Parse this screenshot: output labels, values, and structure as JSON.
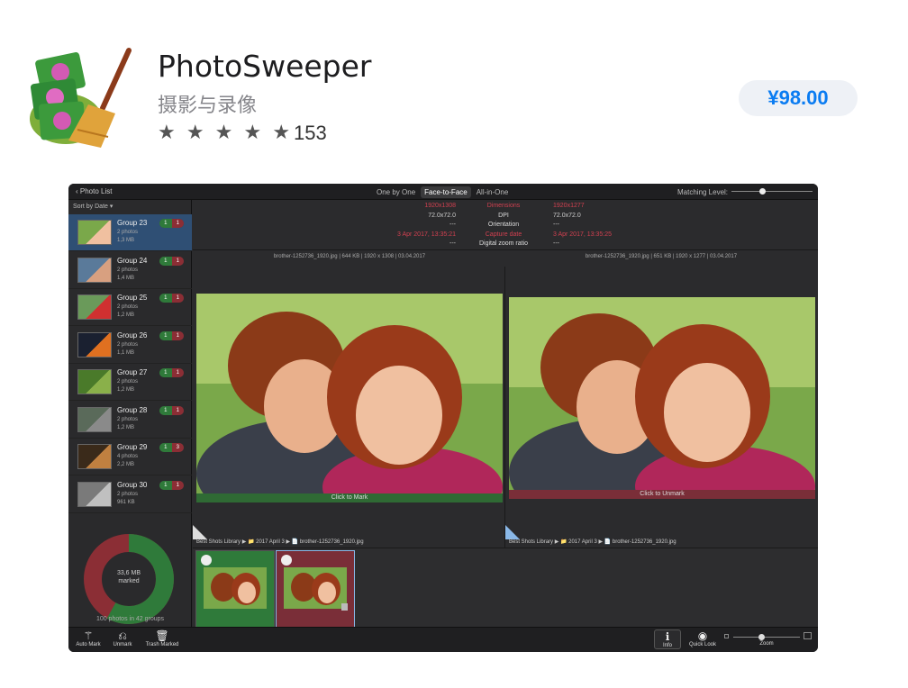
{
  "app": {
    "title": "PhotoSweeper",
    "category": "摄影与录像",
    "stars": "★ ★ ★ ★ ★",
    "rating_count": "153",
    "price": "¥98.00"
  },
  "toolbar": {
    "back": "Photo List",
    "modes": [
      "One by One",
      "Face-to-Face",
      "All-in-One"
    ],
    "matching_label": "Matching Level:"
  },
  "sidebar": {
    "sort": "Sort by Date ▾",
    "groups": [
      {
        "name": "Group 23",
        "photos": "2 photos",
        "size": "1,3 MB",
        "b1": "1",
        "b2": "1"
      },
      {
        "name": "Group 24",
        "photos": "2 photos",
        "size": "1,4 MB",
        "b1": "1",
        "b2": "1"
      },
      {
        "name": "Group 25",
        "photos": "2 photos",
        "size": "1,2 MB",
        "b1": "1",
        "b2": "1"
      },
      {
        "name": "Group 26",
        "photos": "2 photos",
        "size": "1,1 MB",
        "b1": "1",
        "b2": "1"
      },
      {
        "name": "Group 27",
        "photos": "2 photos",
        "size": "1,2 MB",
        "b1": "1",
        "b2": "1"
      },
      {
        "name": "Group 28",
        "photos": "2 photos",
        "size": "1,2 MB",
        "b1": "1",
        "b2": "1"
      },
      {
        "name": "Group 29",
        "photos": "4 photos",
        "size": "2,2 MB",
        "b1": "1",
        "b2": "3"
      },
      {
        "name": "Group 30",
        "photos": "2 photos",
        "size": "961 KB",
        "b1": "1",
        "b2": "1"
      }
    ],
    "marked_size": "33,6 MB",
    "marked_label": "marked",
    "marked_fraction": 0.58,
    "photo_count": "100 photos in 42 groups"
  },
  "info": {
    "labels": [
      "Dimensions",
      "DPI",
      "Orientation",
      "Capture date",
      "Digital zoom ratio"
    ],
    "left": [
      "1920x1308",
      "72.0x72.0",
      "---",
      "3 Apr 2017, 13:35:21",
      "---"
    ],
    "right": [
      "1920x1277",
      "72.0x72.0",
      "---",
      "3 Apr 2017, 13:35:25",
      "---"
    ]
  },
  "left_photo": {
    "header": "brother-1252736_1920.jpg | 644 KB | 1920 x 1308 | 03.04.2017",
    "bar": "Click to Mark",
    "path": "Best Shots Library ▶ 📁 2017 April 3 ▶ 📄 brother-1252736_1920.jpg"
  },
  "right_photo": {
    "header": "brother-1252736_1920.jpg | 651 KB | 1920 x 1277 | 03.04.2017",
    "bar": "Click to Unmark",
    "path": "Best Shots Library ▶ 📁 2017 April 3 ▶ 📄 brother-1252736_1920.jpg"
  },
  "bottom": {
    "auto_mark": "Auto Mark",
    "unmark": "Unmark",
    "trash": "Trash Marked",
    "info": "Info",
    "quick_look": "Quick Look",
    "zoom": "Zoom"
  },
  "colors": {
    "accent": "#0a7cf2",
    "green": "#2f7a3a",
    "red": "#8b2e35",
    "selected": "#2f4f74"
  }
}
